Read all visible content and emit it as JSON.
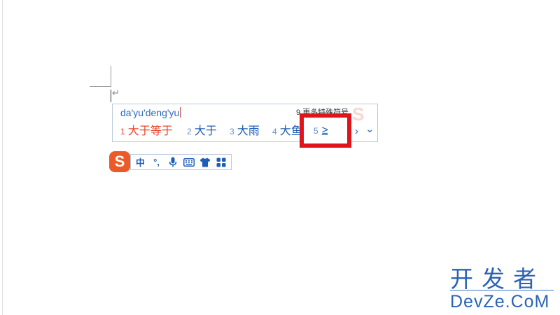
{
  "document": {
    "paragraph_mark": "↵"
  },
  "ime": {
    "composition": "da'yu'deng'yu",
    "hint": "9 更多特殊符号",
    "skin_mark": "S",
    "candidates": [
      {
        "num": "1",
        "text": "大于等于"
      },
      {
        "num": "2",
        "text": "大于"
      },
      {
        "num": "3",
        "text": "大雨"
      },
      {
        "num": "4",
        "text": "大鱼"
      }
    ],
    "highlighted_candidate": {
      "num": "5",
      "text": "≥"
    },
    "next_page_glyph": "›",
    "expand_glyph": "⌄"
  },
  "toolbar": {
    "logo_letter": "S",
    "mode_label": "中",
    "punct_label": "°,",
    "icons": [
      "microphone-icon",
      "keyboard-icon",
      "skin-shirt-icon",
      "toolbox-icon"
    ]
  },
  "watermark": {
    "line1": "开发者",
    "line2": "DevZe.CoM"
  },
  "colors": {
    "accent_blue": "#1f5fb0",
    "first_candidate": "#e8452f",
    "highlight_frame": "#e2141b",
    "logo_orange": "#ec5a2a"
  }
}
